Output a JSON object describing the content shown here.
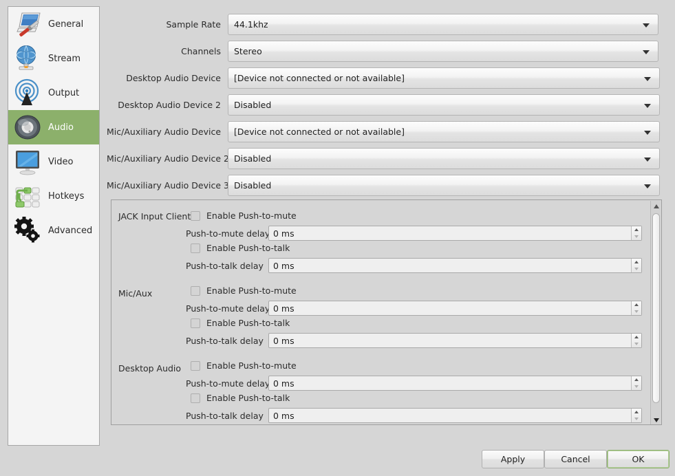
{
  "window": {
    "title": "Settings",
    "background": "#d6d6d6",
    "accent": "#8cb06b"
  },
  "sidebar": {
    "items": [
      {
        "label": "General",
        "icon": "general-icon",
        "selected": false
      },
      {
        "label": "Stream",
        "icon": "stream-icon",
        "selected": false
      },
      {
        "label": "Output",
        "icon": "output-icon",
        "selected": false
      },
      {
        "label": "Audio",
        "icon": "audio-icon",
        "selected": true
      },
      {
        "label": "Video",
        "icon": "video-icon",
        "selected": false
      },
      {
        "label": "Hotkeys",
        "icon": "hotkeys-icon",
        "selected": false
      },
      {
        "label": "Advanced",
        "icon": "advanced-icon",
        "selected": false
      }
    ]
  },
  "audio_settings": {
    "fields": [
      {
        "label": "Sample Rate",
        "value": "44.1khz"
      },
      {
        "label": "Channels",
        "value": "Stereo"
      },
      {
        "label": "Desktop Audio Device",
        "value": "[Device not connected or not available]"
      },
      {
        "label": "Desktop Audio Device 2",
        "value": "Disabled"
      },
      {
        "label": "Mic/Auxiliary Audio Device",
        "value": "[Device not connected or not available]"
      },
      {
        "label": "Mic/Auxiliary Audio Device 2",
        "value": "Disabled"
      },
      {
        "label": "Mic/Auxiliary Audio Device 3",
        "value": "Disabled"
      }
    ]
  },
  "ptt_panel": {
    "groups": [
      {
        "name": "JACK Input Client",
        "push_to_mute_label": "Enable Push-to-mute",
        "push_to_mute_checked": false,
        "push_to_mute_delay_label": "Push-to-mute delay",
        "push_to_mute_delay_value": "0 ms",
        "push_to_talk_label": "Enable Push-to-talk",
        "push_to_talk_checked": false,
        "push_to_talk_delay_label": "Push-to-talk delay",
        "push_to_talk_delay_value": "0 ms"
      },
      {
        "name": "Mic/Aux",
        "push_to_mute_label": "Enable Push-to-mute",
        "push_to_mute_checked": false,
        "push_to_mute_delay_label": "Push-to-mute delay",
        "push_to_mute_delay_value": "0 ms",
        "push_to_talk_label": "Enable Push-to-talk",
        "push_to_talk_checked": false,
        "push_to_talk_delay_label": "Push-to-talk delay",
        "push_to_talk_delay_value": "0 ms"
      },
      {
        "name": "Desktop Audio",
        "push_to_mute_label": "Enable Push-to-mute",
        "push_to_mute_checked": false,
        "push_to_mute_delay_label": "Push-to-mute delay",
        "push_to_mute_delay_value": "0 ms",
        "push_to_talk_label": "Enable Push-to-talk",
        "push_to_talk_checked": false,
        "push_to_talk_delay_label": "Push-to-talk delay",
        "push_to_talk_delay_value": "0 ms"
      }
    ]
  },
  "footer": {
    "apply_label": "Apply",
    "cancel_label": "Cancel",
    "ok_label": "OK"
  }
}
